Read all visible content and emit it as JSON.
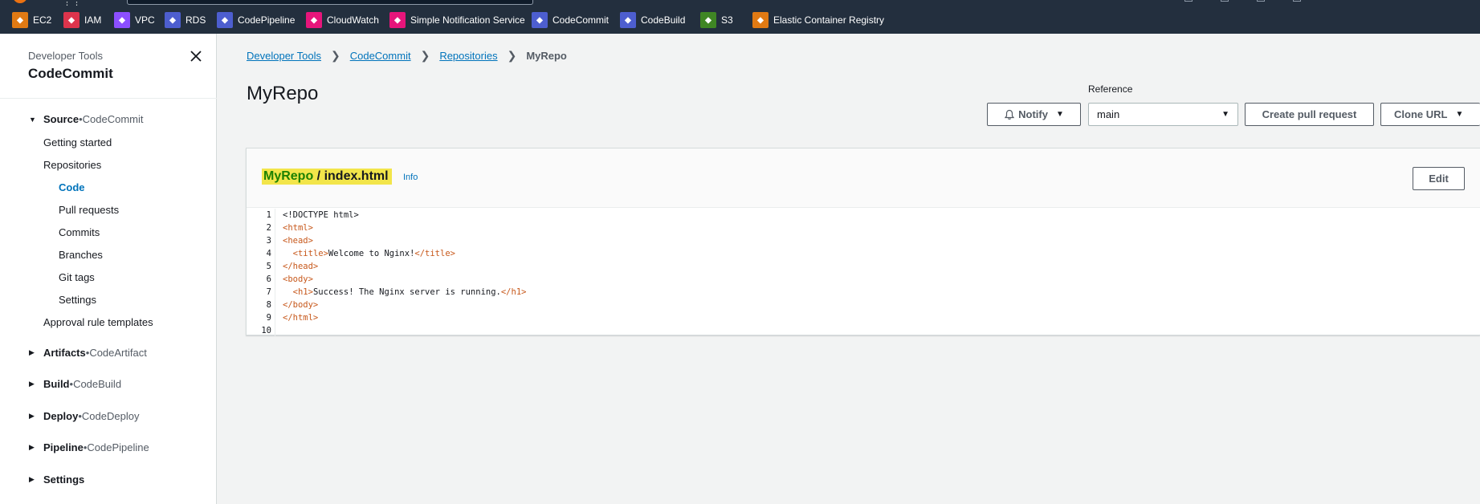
{
  "favorites": [
    {
      "label": "EC2",
      "color": "#e07a14",
      "icon": "ec2-icon"
    },
    {
      "label": "IAM",
      "color": "#dd344c",
      "icon": "iam-icon"
    },
    {
      "label": "VPC",
      "color": "#8c4fff",
      "icon": "vpc-icon"
    },
    {
      "label": "RDS",
      "color": "#4d5ecf",
      "icon": "rds-icon"
    },
    {
      "label": "CodePipeline",
      "color": "#4d5ecf",
      "icon": "codepipeline-icon"
    },
    {
      "label": "CloudWatch",
      "color": "#e7157b",
      "icon": "cloudwatch-icon"
    },
    {
      "label": "Simple Notification Service",
      "color": "#e7157b",
      "icon": "sns-icon"
    },
    {
      "label": "CodeCommit",
      "color": "#4d5ecf",
      "icon": "codecommit-icon"
    },
    {
      "label": "CodeBuild",
      "color": "#4d5ecf",
      "icon": "codebuild-icon"
    },
    {
      "label": "S3",
      "color": "#3f8624",
      "icon": "s3-icon"
    },
    {
      "label": "Elastic Container Registry",
      "color": "#e07a14",
      "icon": "ecr-icon"
    }
  ],
  "sidebar": {
    "parent": "Developer Tools",
    "title": "CodeCommit",
    "source": {
      "name": "Source",
      "service": "CodeCommit"
    },
    "source_items": [
      "Getting started",
      "Repositories"
    ],
    "repo_items": [
      "Code",
      "Pull requests",
      "Commits",
      "Branches",
      "Git tags",
      "Settings"
    ],
    "approval": "Approval rule templates",
    "sections": [
      {
        "name": "Artifacts",
        "service": "CodeArtifact"
      },
      {
        "name": "Build",
        "service": "CodeBuild"
      },
      {
        "name": "Deploy",
        "service": "CodeDeploy"
      },
      {
        "name": "Pipeline",
        "service": "CodePipeline"
      },
      {
        "name": "Settings",
        "service": ""
      }
    ],
    "bullet": " • "
  },
  "breadcrumb": [
    "Developer Tools",
    "CodeCommit",
    "Repositories",
    "MyRepo"
  ],
  "page_title": "MyRepo",
  "toolbar": {
    "notify": "Notify",
    "reference_label": "Reference",
    "reference_value": "main",
    "create_pr": "Create pull request",
    "clone_url": "Clone URL"
  },
  "file": {
    "repo": "MyRepo",
    "path": " / index.html",
    "info": "Info",
    "edit": "Edit",
    "lines": [
      {
        "n": "1",
        "parts": [
          {
            "t": "<!DOCTYPE html>",
            "tag": false
          }
        ]
      },
      {
        "n": "2",
        "parts": [
          {
            "t": "<html>",
            "tag": true
          }
        ]
      },
      {
        "n": "3",
        "parts": [
          {
            "t": "<head>",
            "tag": true
          }
        ]
      },
      {
        "n": "4",
        "parts": [
          {
            "t": "  ",
            "tag": false
          },
          {
            "t": "<title>",
            "tag": true
          },
          {
            "t": "Welcome to Nginx!",
            "tag": false
          },
          {
            "t": "</title>",
            "tag": true
          }
        ]
      },
      {
        "n": "5",
        "parts": [
          {
            "t": "</head>",
            "tag": true
          }
        ]
      },
      {
        "n": "6",
        "parts": [
          {
            "t": "<body>",
            "tag": true
          }
        ]
      },
      {
        "n": "7",
        "parts": [
          {
            "t": "  ",
            "tag": false
          },
          {
            "t": "<h1>",
            "tag": true
          },
          {
            "t": "Success! The Nginx server is running.",
            "tag": false
          },
          {
            "t": "</h1>",
            "tag": true
          }
        ]
      },
      {
        "n": "8",
        "parts": [
          {
            "t": "</body>",
            "tag": true
          }
        ]
      },
      {
        "n": "9",
        "parts": [
          {
            "t": "</html>",
            "tag": true
          }
        ]
      },
      {
        "n": "10",
        "parts": []
      }
    ]
  }
}
